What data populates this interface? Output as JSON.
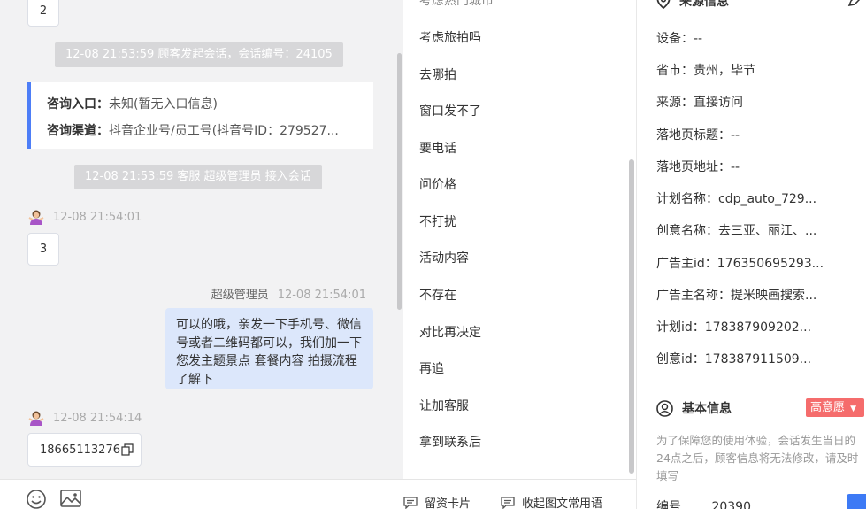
{
  "chat": {
    "prev_message": "2",
    "system_start": "12-08 21:53:59 顾客发起会话，会话编号：24105",
    "entry_label": "咨询入口：",
    "entry_value": "未知(暂无入口信息)",
    "channel_label": "咨询渠道：",
    "channel_value": "抖音企业号/员工号(抖音号ID：279527...",
    "system_join": "12-08 21:53:59 客服 超级管理员 接入会话",
    "customer_time_1": "12-08 21:54:01",
    "customer_msg_1": "3",
    "staff_name": "超级管理员",
    "staff_time": "12-08 21:54:01",
    "staff_msg": "可以的哦，亲发一下手机号、微信号或者二维码都可以，我们加一下您发主题景点 套餐内容 拍摄流程了解下",
    "customer_time_2": "12-08 21:54:14",
    "customer_msg_2": "18665113276"
  },
  "quick_replies": {
    "cut_top": "考虑热门城市",
    "items": [
      "考虑旅拍吗",
      "去哪拍",
      "窗口发不了",
      "要电话",
      "问价格",
      "不打扰",
      "活动内容",
      "不存在",
      "对比再决定",
      "再追",
      "让加客服",
      "拿到联系后"
    ],
    "card_button": "留资卡片",
    "collapse_button": "收起图文常用语"
  },
  "source_info": {
    "title": "来源信息",
    "fields": [
      "设备：--",
      "省市：贵州，毕节",
      "来源：直接访问",
      "落地页标题：--",
      "落地页地址：--",
      "计划名称：cdp_auto_729...",
      "创意名称：去三亚、丽江、...",
      "广告主id：176350695293...",
      "广告主名称：提米映画搜索...",
      "计划id：178387909202...",
      "创意id：178387911509..."
    ]
  },
  "basic_info": {
    "title": "基本信息",
    "intent_badge": "高意愿",
    "note": "为了保障您的使用体验，会话发生当日的24点之后，顾客信息将无法修改，请及时填写",
    "number_label": "编号",
    "number_value": "20390"
  },
  "colors": {
    "accent": "#4d7ef7",
    "staff_bubble": "#dce7fb",
    "badge": "#f56c6c",
    "chat_bg": "#f2f2f3"
  }
}
